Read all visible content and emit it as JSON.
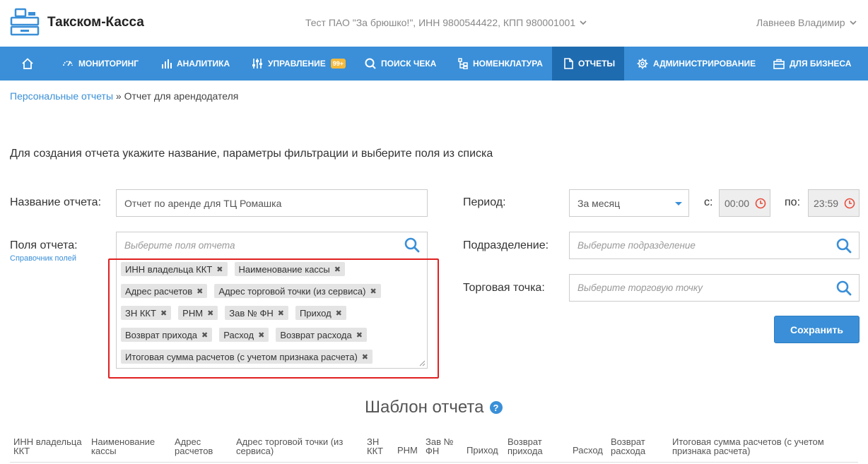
{
  "header": {
    "app_name": "Такском-Касса",
    "organization": "Тест ПАО \"За брюшко!\", ИНН 9800544422, КПП 980001001",
    "user": "Лавнеев Владимир"
  },
  "nav": {
    "items": [
      {
        "label": ""
      },
      {
        "label": "Мониторинг"
      },
      {
        "label": "Аналитика"
      },
      {
        "label": "Управление",
        "badge": "99+"
      },
      {
        "label": "Поиск чека"
      },
      {
        "label": "Номенклатура"
      },
      {
        "label": "Отчеты"
      },
      {
        "label": "Администрирование"
      },
      {
        "label": "Для бизнеса"
      }
    ]
  },
  "breadcrumb": {
    "parent": "Персональные отчеты",
    "separator": "»",
    "current": "Отчет для арендодателя"
  },
  "intro": "Для создания отчета укажите название, параметры фильтрации и выберите поля из списка",
  "form": {
    "name_label": "Название отчета:",
    "name_value": "Отчет по аренде для ТЦ Ромашка",
    "fields_label": "Поля отчета:",
    "fields_link": "Справочник полей",
    "fields_placeholder": "Выберите поля отчета",
    "selected_fields": [
      "ИНН владельца ККТ",
      "Наименование кассы",
      "Адрес расчетов",
      "Адрес торговой точки (из сервиса)",
      "ЗН ККТ",
      "РНМ",
      "Зав № ФН",
      "Приход",
      "Возврат прихода",
      "Расход",
      "Возврат расхода",
      "Итоговая сумма расчетов (с учетом признака расчета)"
    ],
    "tag_remove": "✖",
    "period_label": "Период:",
    "period_value": "За месяц",
    "from_label": "с:",
    "from_time": "00:00",
    "to_label": "по:",
    "to_time": "23:59",
    "division_label": "Подразделение:",
    "division_placeholder": "Выберите подразделение",
    "point_label": "Торговая точка:",
    "point_placeholder": "Выберите торговую точку",
    "save_label": "Сохранить"
  },
  "template": {
    "title": "Шаблон отчета",
    "help": "?",
    "columns": [
      [
        "ИНН владельца",
        "ККТ"
      ],
      [
        "Наименование",
        "кассы"
      ],
      [
        "Адрес",
        "расчетов"
      ],
      [
        "Адрес торговой точки (из",
        "сервиса)"
      ],
      [
        "ЗН",
        "ККТ"
      ],
      [
        "РНМ"
      ],
      [
        "Зав №",
        "ФН"
      ],
      [
        "Приход"
      ],
      [
        "Возврат",
        "прихода"
      ],
      [
        "Расход"
      ],
      [
        "Возврат",
        "расхода"
      ],
      [
        "Итоговая сумма расчетов (с учетом",
        "признака расчета)"
      ]
    ]
  },
  "colors": {
    "brand": "#3a8fd8",
    "nav_active": "#1f6bb0",
    "highlight": "#e02020",
    "badge": "#f5b93b"
  }
}
